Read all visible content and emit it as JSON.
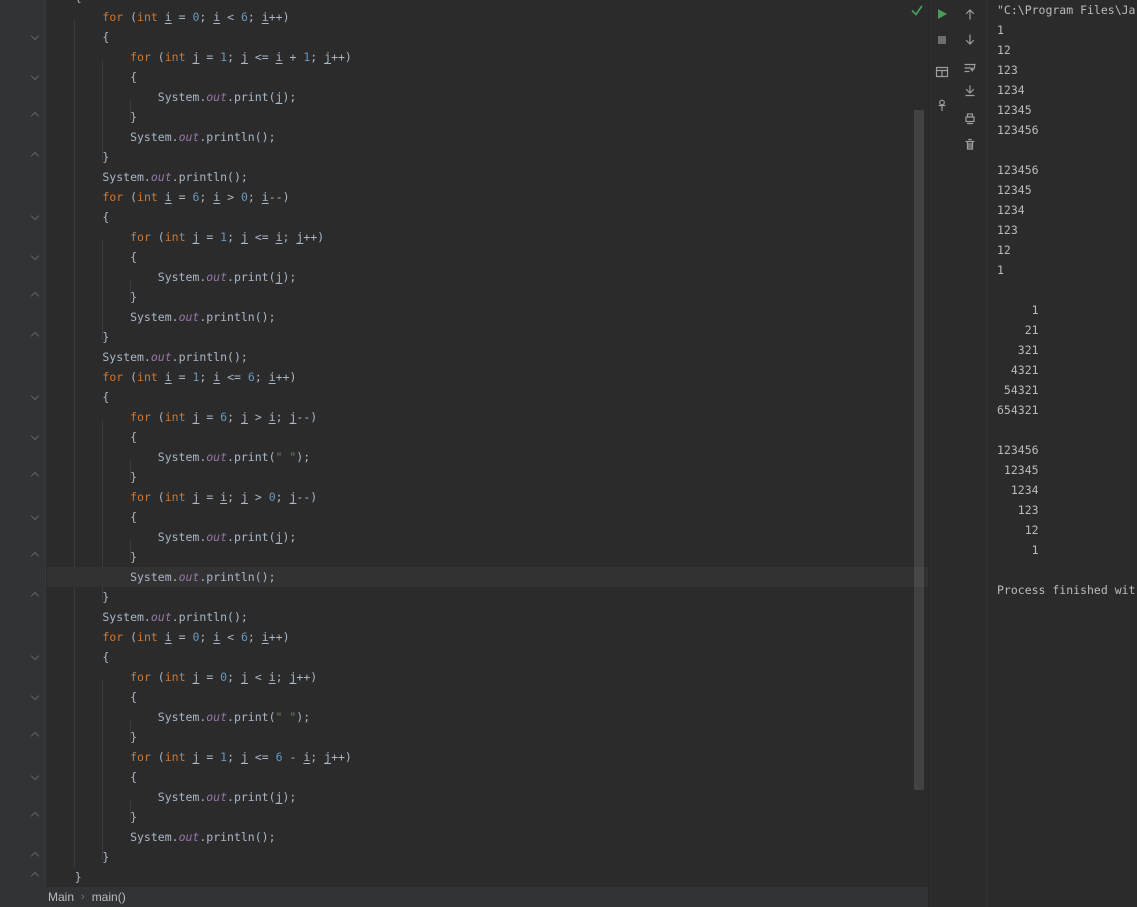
{
  "palette": {
    "editor_bg": "#2b2b2b",
    "gutter_bg": "#313335",
    "caret_line_bg": "#323232",
    "keyword": "#cc7832",
    "number": "#6897bb",
    "string": "#6a8759",
    "field": "#9876aa",
    "text": "#a9b7c6",
    "console_text": "#bbbbbb",
    "run_green": "#499c54",
    "icon_gray": "#9e9e9e"
  },
  "editor": {
    "caret_line": 29,
    "lines": [
      [
        [
          "p",
          "    {"
        ]
      ],
      [
        [
          "p",
          "        "
        ],
        [
          "k",
          "for"
        ],
        [
          "p",
          " ("
        ],
        [
          "k",
          "int"
        ],
        [
          "p",
          " "
        ],
        [
          "v",
          "i"
        ],
        [
          "p",
          " = "
        ],
        [
          "n",
          "0"
        ],
        [
          "p",
          "; "
        ],
        [
          "v",
          "i"
        ],
        [
          "p",
          " < "
        ],
        [
          "n",
          "6"
        ],
        [
          "p",
          "; "
        ],
        [
          "v",
          "i"
        ],
        [
          "p",
          "++)"
        ]
      ],
      [
        [
          "p",
          "        {"
        ]
      ],
      [
        [
          "p",
          "            "
        ],
        [
          "k",
          "for"
        ],
        [
          "p",
          " ("
        ],
        [
          "k",
          "int"
        ],
        [
          "p",
          " "
        ],
        [
          "v",
          "j"
        ],
        [
          "p",
          " = "
        ],
        [
          "n",
          "1"
        ],
        [
          "p",
          "; "
        ],
        [
          "v",
          "j"
        ],
        [
          "p",
          " <= "
        ],
        [
          "v",
          "i"
        ],
        [
          "p",
          " + "
        ],
        [
          "n",
          "1"
        ],
        [
          "p",
          "; "
        ],
        [
          "v",
          "j"
        ],
        [
          "p",
          "++)"
        ]
      ],
      [
        [
          "p",
          "            {"
        ]
      ],
      [
        [
          "p",
          "                System."
        ],
        [
          "f",
          "out"
        ],
        [
          "p",
          ".print("
        ],
        [
          "v",
          "j"
        ],
        [
          "p",
          ");"
        ]
      ],
      [
        [
          "p",
          "            }"
        ]
      ],
      [
        [
          "p",
          "            System."
        ],
        [
          "f",
          "out"
        ],
        [
          "p",
          ".println();"
        ]
      ],
      [
        [
          "p",
          "        }"
        ]
      ],
      [
        [
          "p",
          "        System."
        ],
        [
          "f",
          "out"
        ],
        [
          "p",
          ".println();"
        ]
      ],
      [
        [
          "p",
          "        "
        ],
        [
          "k",
          "for"
        ],
        [
          "p",
          " ("
        ],
        [
          "k",
          "int"
        ],
        [
          "p",
          " "
        ],
        [
          "v",
          "i"
        ],
        [
          "p",
          " = "
        ],
        [
          "n",
          "6"
        ],
        [
          "p",
          "; "
        ],
        [
          "v",
          "i"
        ],
        [
          "p",
          " > "
        ],
        [
          "n",
          "0"
        ],
        [
          "p",
          "; "
        ],
        [
          "v",
          "i"
        ],
        [
          "p",
          "--)"
        ]
      ],
      [
        [
          "p",
          "        {"
        ]
      ],
      [
        [
          "p",
          "            "
        ],
        [
          "k",
          "for"
        ],
        [
          "p",
          " ("
        ],
        [
          "k",
          "int"
        ],
        [
          "p",
          " "
        ],
        [
          "v",
          "j"
        ],
        [
          "p",
          " = "
        ],
        [
          "n",
          "1"
        ],
        [
          "p",
          "; "
        ],
        [
          "v",
          "j"
        ],
        [
          "p",
          " <= "
        ],
        [
          "v",
          "i"
        ],
        [
          "p",
          "; "
        ],
        [
          "v",
          "j"
        ],
        [
          "p",
          "++)"
        ]
      ],
      [
        [
          "p",
          "            {"
        ]
      ],
      [
        [
          "p",
          "                System."
        ],
        [
          "f",
          "out"
        ],
        [
          "p",
          ".print("
        ],
        [
          "v",
          "j"
        ],
        [
          "p",
          ");"
        ]
      ],
      [
        [
          "p",
          "            }"
        ]
      ],
      [
        [
          "p",
          "            System."
        ],
        [
          "f",
          "out"
        ],
        [
          "p",
          ".println();"
        ]
      ],
      [
        [
          "p",
          "        }"
        ]
      ],
      [
        [
          "p",
          "        System."
        ],
        [
          "f",
          "out"
        ],
        [
          "p",
          ".println();"
        ]
      ],
      [
        [
          "p",
          "        "
        ],
        [
          "k",
          "for"
        ],
        [
          "p",
          " ("
        ],
        [
          "k",
          "int"
        ],
        [
          "p",
          " "
        ],
        [
          "v",
          "i"
        ],
        [
          "p",
          " = "
        ],
        [
          "n",
          "1"
        ],
        [
          "p",
          "; "
        ],
        [
          "v",
          "i"
        ],
        [
          "p",
          " <= "
        ],
        [
          "n",
          "6"
        ],
        [
          "p",
          "; "
        ],
        [
          "v",
          "i"
        ],
        [
          "p",
          "++)"
        ]
      ],
      [
        [
          "p",
          "        {"
        ]
      ],
      [
        [
          "p",
          "            "
        ],
        [
          "k",
          "for"
        ],
        [
          "p",
          " ("
        ],
        [
          "k",
          "int"
        ],
        [
          "p",
          " "
        ],
        [
          "v",
          "j"
        ],
        [
          "p",
          " = "
        ],
        [
          "n",
          "6"
        ],
        [
          "p",
          "; "
        ],
        [
          "v",
          "j"
        ],
        [
          "p",
          " > "
        ],
        [
          "v",
          "i"
        ],
        [
          "p",
          "; "
        ],
        [
          "v",
          "j"
        ],
        [
          "p",
          "--)"
        ]
      ],
      [
        [
          "p",
          "            {"
        ]
      ],
      [
        [
          "p",
          "                System."
        ],
        [
          "f",
          "out"
        ],
        [
          "p",
          ".print("
        ],
        [
          "s",
          "\" \""
        ],
        [
          "p",
          ");"
        ]
      ],
      [
        [
          "p",
          "            }"
        ]
      ],
      [
        [
          "p",
          "            "
        ],
        [
          "k",
          "for"
        ],
        [
          "p",
          " ("
        ],
        [
          "k",
          "int"
        ],
        [
          "p",
          " "
        ],
        [
          "v",
          "j"
        ],
        [
          "p",
          " = "
        ],
        [
          "v",
          "i"
        ],
        [
          "p",
          "; "
        ],
        [
          "v",
          "j"
        ],
        [
          "p",
          " > "
        ],
        [
          "n",
          "0"
        ],
        [
          "p",
          "; "
        ],
        [
          "v",
          "j"
        ],
        [
          "p",
          "--)"
        ]
      ],
      [
        [
          "p",
          "            {"
        ]
      ],
      [
        [
          "p",
          "                System."
        ],
        [
          "f",
          "out"
        ],
        [
          "p",
          ".print("
        ],
        [
          "v",
          "j"
        ],
        [
          "p",
          ");"
        ]
      ],
      [
        [
          "p",
          "            }"
        ]
      ],
      [
        [
          "p",
          "            System."
        ],
        [
          "f",
          "out"
        ],
        [
          "p",
          ".println();"
        ]
      ],
      [
        [
          "p",
          "        }"
        ]
      ],
      [
        [
          "p",
          "        System."
        ],
        [
          "f",
          "out"
        ],
        [
          "p",
          ".println();"
        ]
      ],
      [
        [
          "p",
          "        "
        ],
        [
          "k",
          "for"
        ],
        [
          "p",
          " ("
        ],
        [
          "k",
          "int"
        ],
        [
          "p",
          " "
        ],
        [
          "v",
          "i"
        ],
        [
          "p",
          " = "
        ],
        [
          "n",
          "0"
        ],
        [
          "p",
          "; "
        ],
        [
          "v",
          "i"
        ],
        [
          "p",
          " < "
        ],
        [
          "n",
          "6"
        ],
        [
          "p",
          "; "
        ],
        [
          "v",
          "i"
        ],
        [
          "p",
          "++)"
        ]
      ],
      [
        [
          "p",
          "        {"
        ]
      ],
      [
        [
          "p",
          "            "
        ],
        [
          "k",
          "for"
        ],
        [
          "p",
          " ("
        ],
        [
          "k",
          "int"
        ],
        [
          "p",
          " "
        ],
        [
          "v",
          "j"
        ],
        [
          "p",
          " = "
        ],
        [
          "n",
          "0"
        ],
        [
          "p",
          "; "
        ],
        [
          "v",
          "j"
        ],
        [
          "p",
          " < "
        ],
        [
          "v",
          "i"
        ],
        [
          "p",
          "; "
        ],
        [
          "v",
          "j"
        ],
        [
          "p",
          "++)"
        ]
      ],
      [
        [
          "p",
          "            {"
        ]
      ],
      [
        [
          "p",
          "                System."
        ],
        [
          "f",
          "out"
        ],
        [
          "p",
          ".print("
        ],
        [
          "s",
          "\" \""
        ],
        [
          "p",
          ");"
        ]
      ],
      [
        [
          "p",
          "            }"
        ]
      ],
      [
        [
          "p",
          "            "
        ],
        [
          "k",
          "for"
        ],
        [
          "p",
          " ("
        ],
        [
          "k",
          "int"
        ],
        [
          "p",
          " "
        ],
        [
          "v",
          "j"
        ],
        [
          "p",
          " = "
        ],
        [
          "n",
          "1"
        ],
        [
          "p",
          "; "
        ],
        [
          "v",
          "j"
        ],
        [
          "p",
          " <= "
        ],
        [
          "n",
          "6"
        ],
        [
          "p",
          " - "
        ],
        [
          "v",
          "i"
        ],
        [
          "p",
          "; "
        ],
        [
          "v",
          "j"
        ],
        [
          "p",
          "++)"
        ]
      ],
      [
        [
          "p",
          "            {"
        ]
      ],
      [
        [
          "p",
          "                System."
        ],
        [
          "f",
          "out"
        ],
        [
          "p",
          ".print("
        ],
        [
          "v",
          "j"
        ],
        [
          "p",
          ");"
        ]
      ],
      [
        [
          "p",
          "            }"
        ]
      ],
      [
        [
          "p",
          "            System."
        ],
        [
          "f",
          "out"
        ],
        [
          "p",
          ".println();"
        ]
      ],
      [
        [
          "p",
          "        }"
        ]
      ],
      [
        [
          "p",
          "    }"
        ]
      ]
    ]
  },
  "breadcrumbs": {
    "separator": "›",
    "items": [
      {
        "label": "Main"
      },
      {
        "label": "main()"
      }
    ]
  },
  "inspection": {
    "name": "inspections-ok-icon",
    "glyph": "check",
    "color": "#499c54"
  },
  "run_toolbar": {
    "icons": [
      {
        "name": "run-button",
        "glyph": "play",
        "color": "#499c54"
      },
      {
        "name": "stop-button",
        "glyph": "stop",
        "color": "#6e6e6e"
      },
      {
        "name": "restore-layout-button",
        "glyph": "layout",
        "color": "#9e9e9e"
      },
      {
        "name": "pin-tab-button",
        "glyph": "pin",
        "color": "#9e9e9e"
      }
    ]
  },
  "console_toolbar": {
    "icons": [
      {
        "name": "up-stack-trace-button",
        "glyph": "arrow-up",
        "color": "#9e9e9e"
      },
      {
        "name": "down-stack-trace-button",
        "glyph": "arrow-down",
        "color": "#9e9e9e"
      },
      {
        "name": "soft-wrap-button",
        "glyph": "soft-wrap",
        "color": "#9e9e9e"
      },
      {
        "name": "scroll-to-end-button",
        "glyph": "scroll-end",
        "color": "#9e9e9e"
      },
      {
        "name": "print-button",
        "glyph": "printer",
        "color": "#9e9e9e"
      },
      {
        "name": "clear-output-button",
        "glyph": "trash",
        "color": "#9e9e9e"
      }
    ]
  },
  "console": {
    "lines": [
      "\"C:\\Program Files\\Ja",
      "1",
      "12",
      "123",
      "1234",
      "12345",
      "123456",
      "",
      "123456",
      "12345",
      "1234",
      "123",
      "12",
      "1",
      "",
      "     1",
      "    21",
      "   321",
      "  4321",
      " 54321",
      "654321",
      "",
      "123456",
      " 12345",
      "  1234",
      "   123",
      "    12",
      "     1",
      "",
      "Process finished wit"
    ]
  }
}
